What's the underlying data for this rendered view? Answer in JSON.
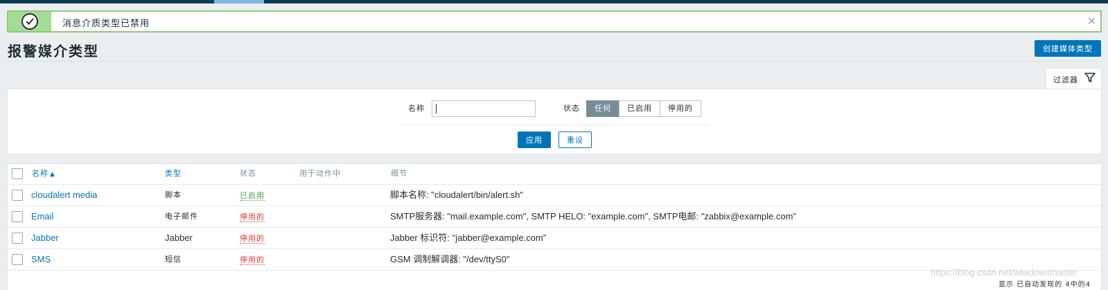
{
  "message": {
    "text": "消息介质类型已禁用",
    "close": "×"
  },
  "page": {
    "title": "报警媒介类型",
    "create_button": "创建媒体类型"
  },
  "filter": {
    "tab_label": "过滤器",
    "name_label": "名称",
    "name_value": "",
    "status_label": "状态",
    "status_options": [
      "任何",
      "已启用",
      "停用的"
    ],
    "status_selected": "任何",
    "apply_button": "应用",
    "reset_button": "重设"
  },
  "table": {
    "headers": {
      "name": "名称",
      "type": "类型",
      "status": "状态",
      "used_in_actions": "用于动作中",
      "details": "细节"
    },
    "rows": [
      {
        "name": "cloudalert media",
        "type": "脚本",
        "status": "已启用",
        "used_in_actions": "",
        "details": "脚本名称: \"cloudalert/bin/alert.sh\""
      },
      {
        "name": "Email",
        "type": "电子邮件",
        "status": "停用的",
        "used_in_actions": "",
        "details": "SMTP服务器: \"mail.example.com\", SMTP HELO: \"example.com\", SMTP电邮: \"zabbix@example.com\""
      },
      {
        "name": "Jabber",
        "type": "Jabber",
        "status": "停用的",
        "used_in_actions": "",
        "details": "Jabber 标识符: \"jabber@example.com\""
      },
      {
        "name": "SMS",
        "type": "短信",
        "status": "停用的",
        "used_in_actions": "",
        "details": "GSM 调制解调器: \"/dev/ttyS0\""
      }
    ],
    "footer": "显示 已自动发现的 4中的4"
  },
  "watermark": "https://blog.csdn.net/wiwdowsmaster",
  "colors": {
    "accent": "#0275b8",
    "enabled": "#429e47",
    "disabled": "#e33734",
    "success_bg": "#a4dc95"
  }
}
